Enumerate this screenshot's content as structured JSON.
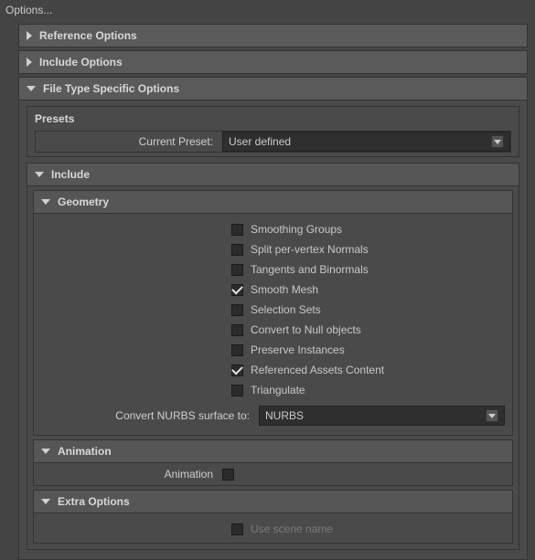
{
  "window": {
    "title": "Options..."
  },
  "sections": {
    "reference": "Reference Options",
    "includeOptions": "Include Options",
    "fileType": "File Type Specific Options"
  },
  "presets": {
    "title": "Presets",
    "currentPresetLabel": "Current Preset:",
    "currentPresetValue": "User defined"
  },
  "include": {
    "title": "Include",
    "geometry": {
      "title": "Geometry",
      "checkboxes": {
        "smoothingGroups": "Smoothing Groups",
        "splitPerVertexNormals": "Split per-vertex Normals",
        "tangentsBinormals": "Tangents and Binormals",
        "smoothMesh": "Smooth Mesh",
        "selectionSets": "Selection Sets",
        "convertNullObjects": "Convert to Null objects",
        "preserveInstances": "Preserve Instances",
        "referencedAssets": "Referenced Assets Content",
        "triangulate": "Triangulate"
      },
      "convertNurbsLabel": "Convert NURBS surface to:",
      "convertNurbsValue": "NURBS"
    },
    "animation": {
      "title": "Animation",
      "label": "Animation"
    },
    "extraOptions": {
      "title": "Extra Options",
      "useSceneName": "Use scene name"
    }
  }
}
